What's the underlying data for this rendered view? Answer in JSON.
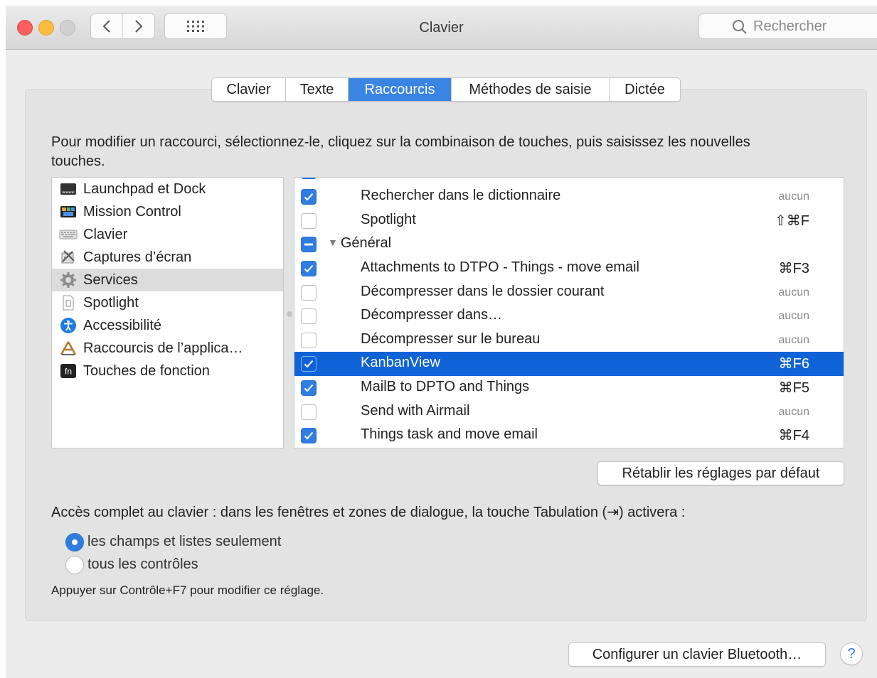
{
  "window": {
    "title": "Clavier"
  },
  "search": {
    "placeholder": "Rechercher"
  },
  "tabs": [
    {
      "label": "Clavier",
      "active": false
    },
    {
      "label": "Texte",
      "active": false
    },
    {
      "label": "Raccourcis",
      "active": true
    },
    {
      "label": "Méthodes de saisie",
      "active": false
    },
    {
      "label": "Dictée",
      "active": false
    }
  ],
  "instructions": "Pour modifier un raccourci, sélectionnez-le, cliquez sur la combinaison de touches, puis saisissez les nouvelles touches.",
  "categories": [
    {
      "label": "Launchpad et Dock",
      "icon": "launchpad-icon",
      "selected": false
    },
    {
      "label": "Mission Control",
      "icon": "mission-control-icon",
      "selected": false
    },
    {
      "label": "Clavier",
      "icon": "keyboard-icon",
      "selected": false
    },
    {
      "label": "Captures d’écran",
      "icon": "screenshot-icon",
      "selected": false
    },
    {
      "label": "Services",
      "icon": "gear-icon",
      "selected": true
    },
    {
      "label": "Spotlight",
      "icon": "document-icon",
      "selected": false
    },
    {
      "label": "Accessibilité",
      "icon": "accessibility-icon",
      "selected": false
    },
    {
      "label": "Raccourcis de l’applica…",
      "icon": "app-store-icon",
      "selected": false
    },
    {
      "label": "Touches de fonction",
      "icon": "fn-key-icon",
      "selected": false
    }
  ],
  "shortcuts": [
    {
      "label": "Rechercher dans le dictionnaire",
      "state": "checked",
      "key": "aucun",
      "none": true
    },
    {
      "label": "Spotlight",
      "state": "unchecked",
      "key": "⇧⌘F",
      "none": false
    },
    {
      "label": "Général",
      "state": "mixed",
      "key": "",
      "none": false,
      "group": true
    },
    {
      "label": "Attachments to DTPO - Things - move email",
      "state": "checked",
      "key": "⌘F3",
      "none": false
    },
    {
      "label": "Décompresser dans le dossier courant",
      "state": "unchecked",
      "key": "aucun",
      "none": true
    },
    {
      "label": "Décompresser dans…",
      "state": "unchecked",
      "key": "aucun",
      "none": true
    },
    {
      "label": "Décompresser sur le bureau",
      "state": "unchecked",
      "key": "aucun",
      "none": true
    },
    {
      "label": "KanbanView",
      "state": "checked",
      "key": "⌘F6",
      "none": false,
      "selected": true
    },
    {
      "label": "MailB to DPTO and Things",
      "state": "checked",
      "key": "⌘F5",
      "none": false
    },
    {
      "label": "Send with Airmail",
      "state": "unchecked",
      "key": "aucun",
      "none": true
    },
    {
      "label": "Things task and move email",
      "state": "checked",
      "key": "⌘F4",
      "none": false
    }
  ],
  "buttons": {
    "restore_defaults": "Rétablir les réglages par défaut",
    "bluetooth": "Configurer un clavier Bluetooth…",
    "help": "?"
  },
  "full_keyboard_access": {
    "label": "Accès complet au clavier : dans les fenêtres et zones de dialogue, la touche Tabulation (⇥) activera :",
    "options": [
      {
        "label": "les champs et listes seulement",
        "selected": true
      },
      {
        "label": "tous les contrôles",
        "selected": false
      }
    ],
    "hint": "Appuyer sur Contrôle+F7 pour modifier ce réglage."
  },
  "colors": {
    "accent": "#2f7de1",
    "selection": "#0f63d6"
  }
}
